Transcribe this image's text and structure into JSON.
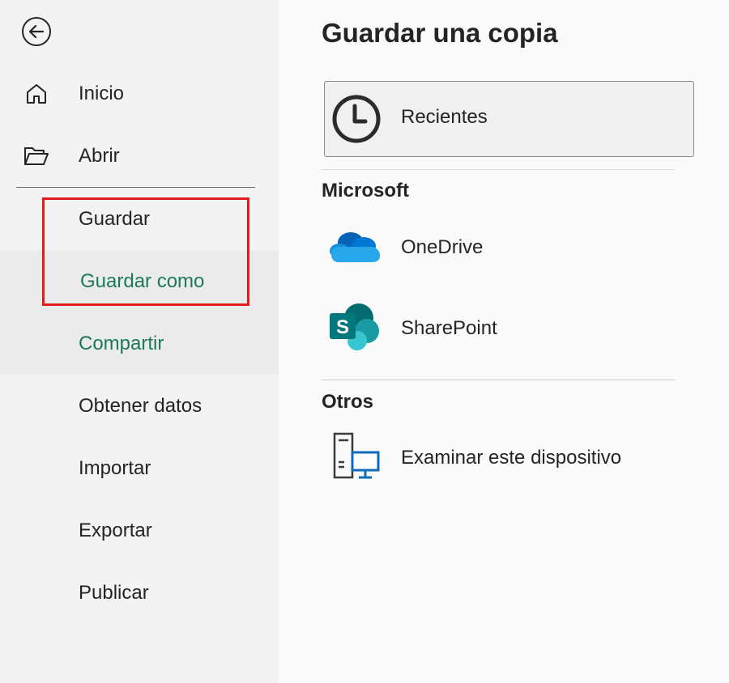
{
  "sidebar": {
    "back_icon": "arrow-left-circle-icon",
    "items": [
      {
        "label": "Inicio",
        "icon": "home-icon"
      },
      {
        "label": "Abrir",
        "icon": "folder-open-icon"
      },
      {
        "label": "Guardar"
      },
      {
        "label": "Guardar como"
      },
      {
        "label": "Compartir"
      },
      {
        "label": "Obtener datos"
      },
      {
        "label": "Importar"
      },
      {
        "label": "Exportar"
      },
      {
        "label": "Publicar"
      }
    ],
    "selected_index": 3
  },
  "main": {
    "title": "Guardar una copia",
    "recent": {
      "label": "Recientes",
      "icon": "clock-icon"
    },
    "sections": [
      {
        "heading": "Microsoft",
        "locations": [
          {
            "label": "OneDrive",
            "icon": "onedrive-icon"
          },
          {
            "label": "SharePoint",
            "icon": "sharepoint-icon"
          }
        ]
      },
      {
        "heading": "Otros",
        "locations": [
          {
            "label": "Examinar este dispositivo",
            "icon": "computer-icon"
          }
        ]
      }
    ]
  },
  "colors": {
    "accent_green": "#1b7a56",
    "highlight_red": "#e01c1c",
    "sidebar_bg": "#f3f3f3",
    "main_bg": "#fafafa"
  },
  "icons": {
    "sharepoint_letter": "S"
  }
}
